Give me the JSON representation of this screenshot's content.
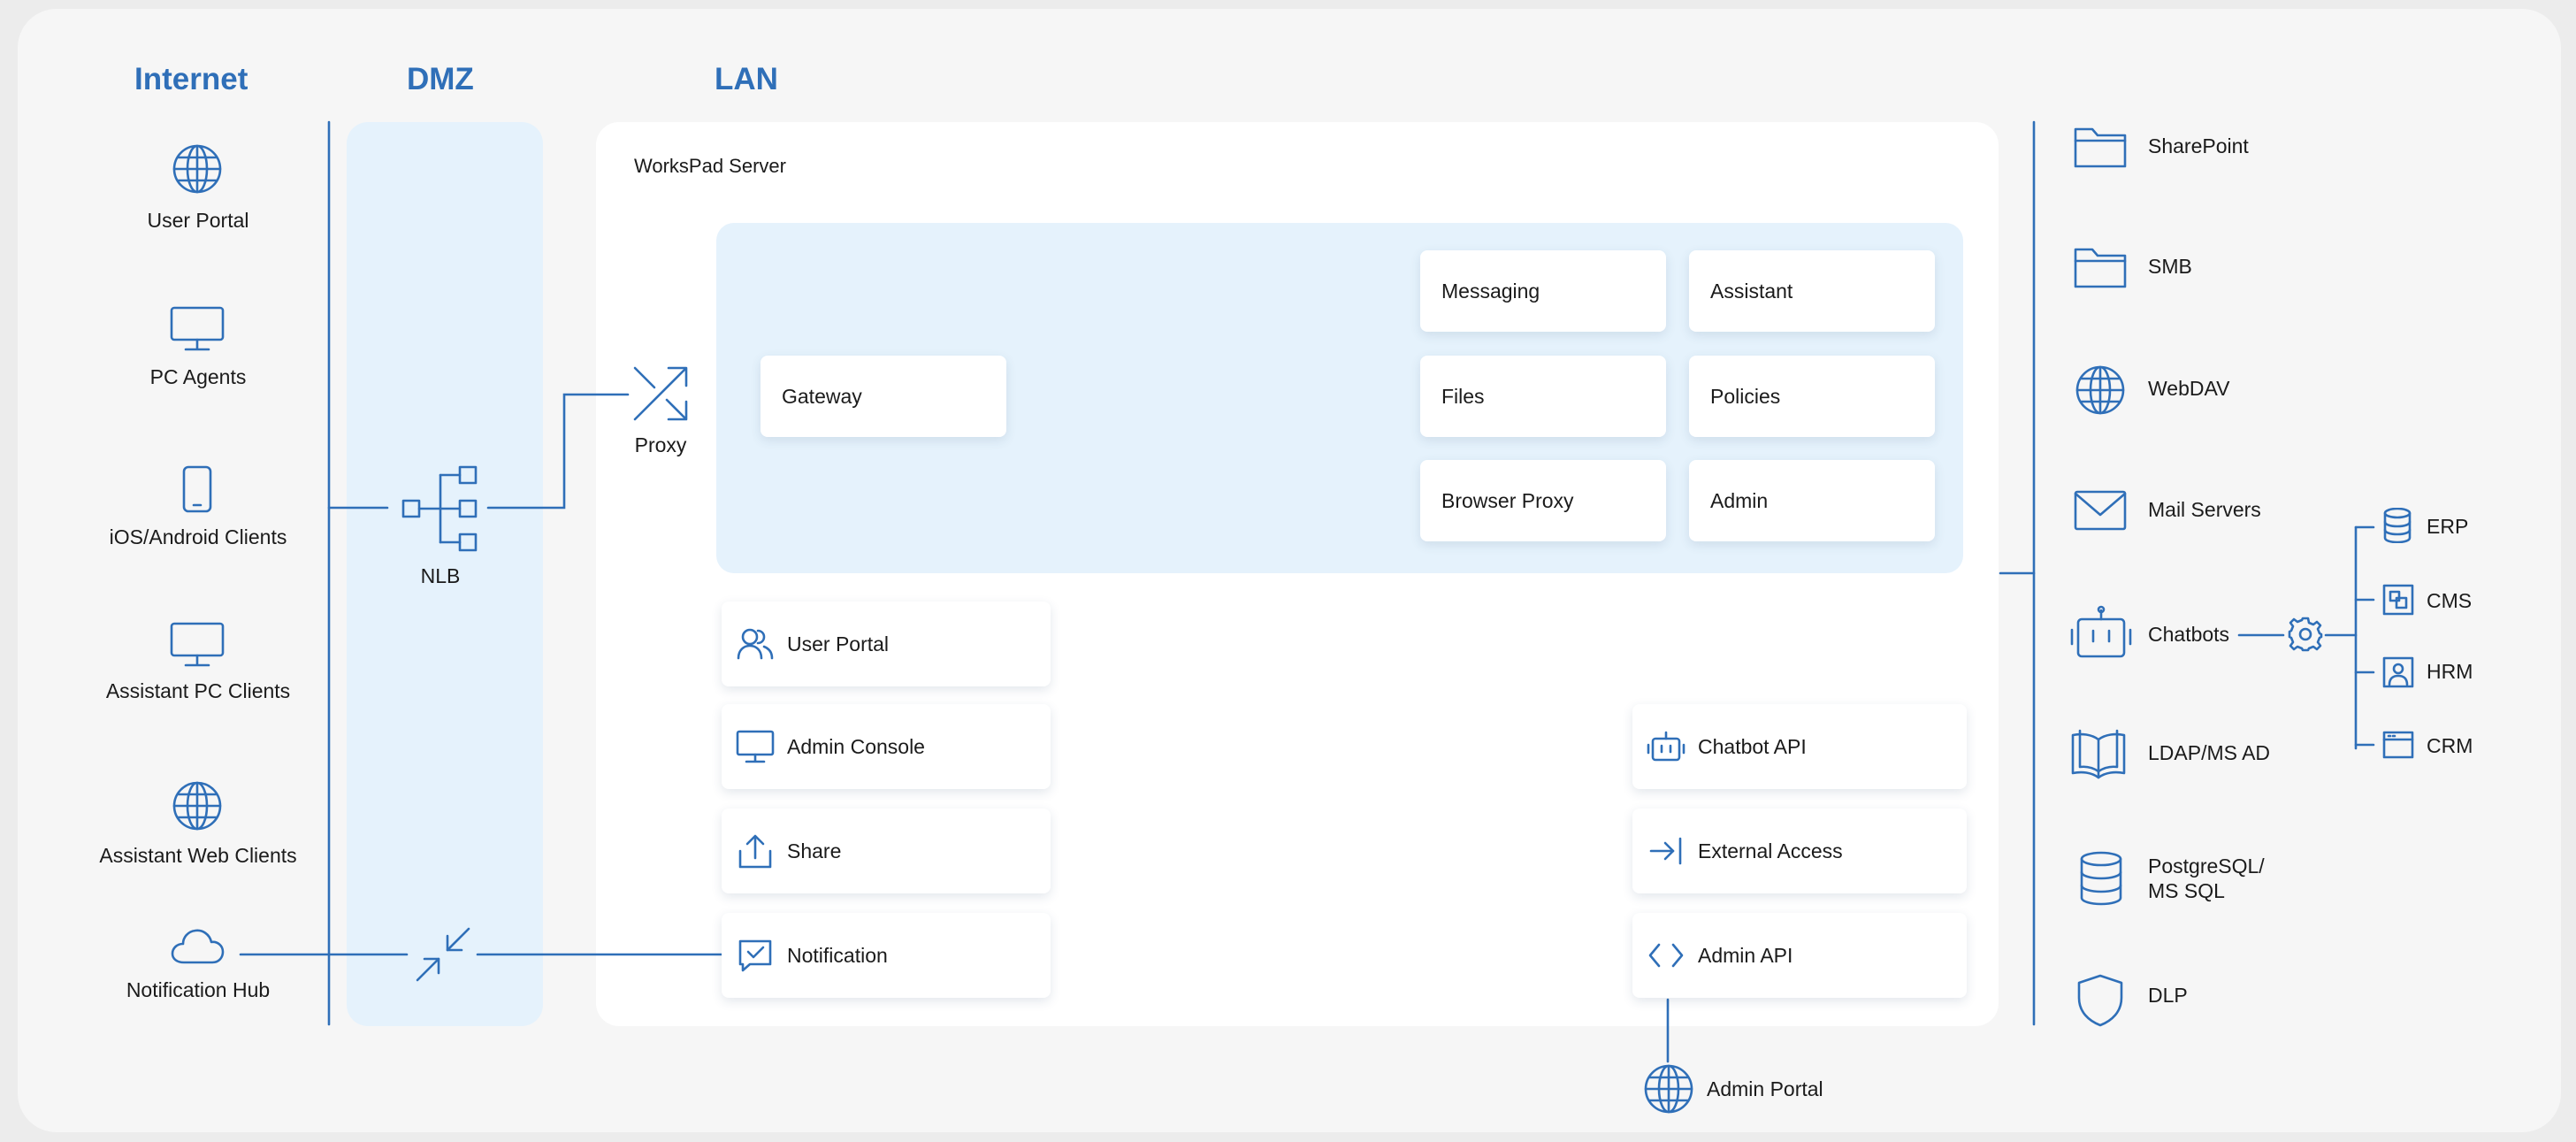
{
  "columns": {
    "internet": "Internet",
    "dmz": "DMZ",
    "lan": "LAN"
  },
  "internet_clients": [
    "User Portal",
    "PC Agents",
    "iOS/Android Clients",
    "Assistant PC Clients",
    "Assistant Web Clients",
    "Notification Hub"
  ],
  "dmz": {
    "nlb": "NLB"
  },
  "server": {
    "title": "WorksPad Server",
    "proxy": "Proxy",
    "gateway": "Gateway",
    "modules": [
      "Messaging",
      "Assistant",
      "Files",
      "Policies",
      "Browser Proxy",
      "Admin"
    ],
    "left_services": [
      "User Portal",
      "Admin Console",
      "Share",
      "Notification"
    ],
    "right_services": [
      "Chatbot API",
      "External Access",
      "Admin API"
    ]
  },
  "admin_portal": "Admin Portal",
  "backends": [
    "SharePoint",
    "SMB",
    "WebDAV",
    "Mail Servers",
    "Chatbots",
    "LDAP/MS AD",
    "PostgreSQL/",
    "MS SQL",
    "DLP"
  ],
  "chatbot_targets": [
    "ERP",
    "CMS",
    "HRM",
    "CRM"
  ],
  "colors": {
    "accent": "#2f6fb8",
    "panel_blue": "#e5f2fc",
    "background": "#f6f6f6"
  },
  "icons": {
    "user_portal": "globe-icon",
    "pc_agents": "monitor-icon",
    "mobile": "smartphone-icon",
    "notification_hub": "cloud-icon",
    "nlb": "network-tree-icon",
    "proxy": "shuffle-arrows-icon",
    "backend_files": "folder-icon",
    "mail": "envelope-icon",
    "chatbot": "robot-icon",
    "ldap": "book-icon",
    "database": "database-icon",
    "dlp": "shield-icon"
  }
}
